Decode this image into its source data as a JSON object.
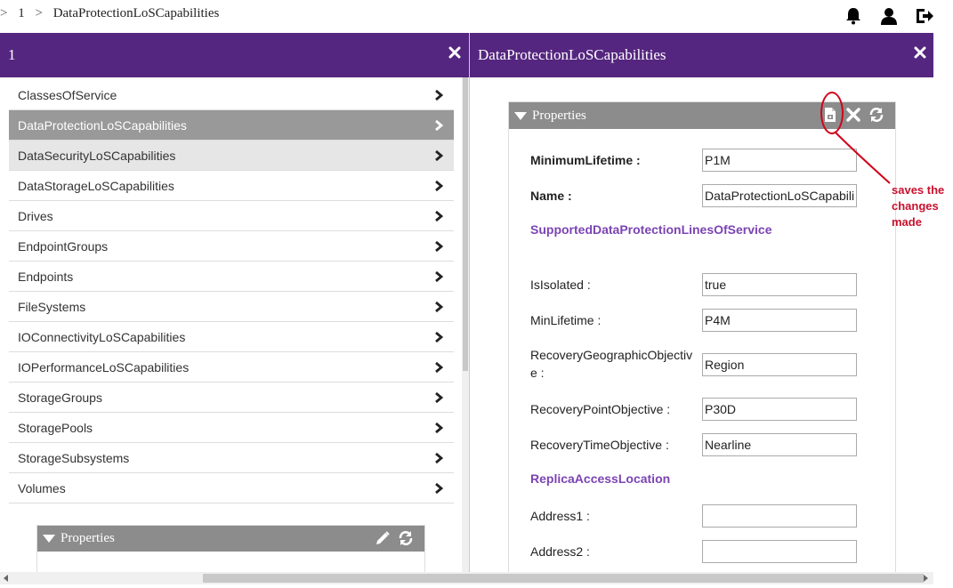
{
  "breadcrumb": {
    "sep1": ">",
    "item1": "1",
    "sep2": ">",
    "item2": "DataProtectionLoSCapabilities"
  },
  "topbar": {
    "icons": [
      "bell-icon",
      "user-icon",
      "logout-icon"
    ]
  },
  "left_panel": {
    "title": "1",
    "items": [
      {
        "label": "ClassesOfService"
      },
      {
        "label": "DataProtectionLoSCapabilities"
      },
      {
        "label": "DataSecurityLoSCapabilities"
      },
      {
        "label": "DataStorageLoSCapabilities"
      },
      {
        "label": "Drives"
      },
      {
        "label": "EndpointGroups"
      },
      {
        "label": "Endpoints"
      },
      {
        "label": "FileSystems"
      },
      {
        "label": "IOConnectivityLoSCapabilities"
      },
      {
        "label": "IOPerformanceLoSCapabilities"
      },
      {
        "label": "StorageGroups"
      },
      {
        "label": "StoragePools"
      },
      {
        "label": "StorageSubsystems"
      },
      {
        "label": "Volumes"
      }
    ],
    "selected_index": 1,
    "hover_index": 2,
    "properties_title": "Properties"
  },
  "right_panel": {
    "title": "DataProtectionLoSCapabilities",
    "properties_title": "Properties",
    "fields": {
      "minimum_lifetime": {
        "label": "MinimumLifetime :",
        "value": "P1M"
      },
      "name": {
        "label": "Name :",
        "value": "DataProtectionLoSCapabili"
      },
      "section_supported": "SupportedDataProtectionLinesOfService",
      "is_isolated": {
        "label": "IsIsolated :",
        "value": "true"
      },
      "min_lifetime": {
        "label": "MinLifetime :",
        "value": "P4M"
      },
      "recovery_geo": {
        "label": "RecoveryGeographicObjective :",
        "value": "Region"
      },
      "recovery_point": {
        "label": "RecoveryPointObjective :",
        "value": "P30D"
      },
      "recovery_time": {
        "label": "RecoveryTimeObjective :",
        "value": "Nearline"
      },
      "section_replica": "ReplicaAccessLocation",
      "address1": {
        "label": "Address1 :",
        "value": ""
      },
      "address2": {
        "label": "Address2 :",
        "value": ""
      }
    }
  },
  "annotation": {
    "text": "saves the changes made",
    "color": "#c8102e"
  },
  "colors": {
    "header_purple": "#55267f",
    "section_purple": "#7b44b3",
    "props_header_gray": "#8c8c8c",
    "selected_gray": "#999999"
  }
}
